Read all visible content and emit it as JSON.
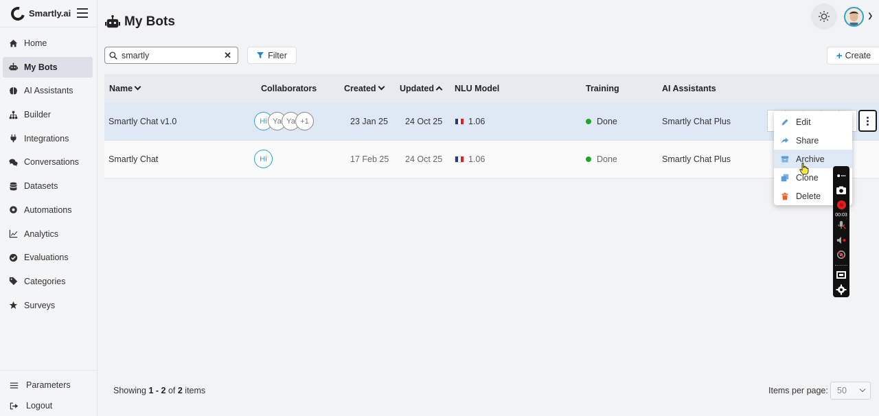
{
  "brand": {
    "name": "Smartly.ai"
  },
  "sidebar": {
    "items": [
      {
        "label": "Home",
        "icon": "home-icon"
      },
      {
        "label": "My Bots",
        "icon": "robot-icon",
        "active": true
      },
      {
        "label": "AI Assistants",
        "icon": "brain-icon"
      },
      {
        "label": "Builder",
        "icon": "sitemap-icon"
      },
      {
        "label": "Integrations",
        "icon": "plug-icon"
      },
      {
        "label": "Conversations",
        "icon": "comments-icon"
      },
      {
        "label": "Datasets",
        "icon": "database-icon"
      },
      {
        "label": "Automations",
        "icon": "robot-arm-icon"
      },
      {
        "label": "Analytics",
        "icon": "line-chart-icon"
      },
      {
        "label": "Evaluations",
        "icon": "check-circle-icon"
      },
      {
        "label": "Categories",
        "icon": "tags-icon"
      },
      {
        "label": "Surveys",
        "icon": "star-icon"
      }
    ],
    "bottom": [
      {
        "label": "Parameters",
        "icon": "sliders-icon"
      },
      {
        "label": "Logout",
        "icon": "logout-icon"
      }
    ]
  },
  "page": {
    "title": "My Bots"
  },
  "search": {
    "value": "smartly"
  },
  "toolbar": {
    "filter_label": "Filter",
    "create_label": "Create"
  },
  "table": {
    "headers": {
      "name": "Name",
      "collaborators": "Collaborators",
      "created": "Created",
      "updated": "Updated",
      "nlu": "NLU Model",
      "training": "Training",
      "assistants": "AI Assistants"
    },
    "rows": [
      {
        "name": "Smartly Chat v1.0",
        "collaborators": [
          "Hi",
          "Ya",
          "Ya",
          "+1"
        ],
        "created": "23 Jan 25",
        "updated": "24 Oct 25",
        "nlu": "1.06",
        "training": "Done",
        "assistants": "Smartly Chat Plus"
      },
      {
        "name": "Smartly Chat",
        "collaborators": [
          "Hi"
        ],
        "created": "17 Feb 25",
        "updated": "24 Oct 25",
        "nlu": "1.06",
        "training": "Done",
        "assistants": "Smartly Chat Plus"
      }
    ]
  },
  "menu": {
    "items": [
      {
        "label": "Edit",
        "icon": "pencil-icon"
      },
      {
        "label": "Share",
        "icon": "share-icon"
      },
      {
        "label": "Archive",
        "icon": "archive-icon",
        "hovered": true
      },
      {
        "label": "Clone",
        "icon": "clone-icon"
      },
      {
        "label": "Delete",
        "icon": "trash-icon"
      }
    ]
  },
  "footer": {
    "showing_prefix": "Showing",
    "range": "1 - 2",
    "of": "of",
    "total": "2",
    "items_word": "items",
    "per_page_label": "Items per page:",
    "per_page_value": "50"
  },
  "recorder": {
    "time": "00:03"
  },
  "colors": {
    "accent": "#1b86c9",
    "success": "#1fa52a",
    "row_highlight": "#dfe9f6",
    "delete": "#e8632b"
  }
}
